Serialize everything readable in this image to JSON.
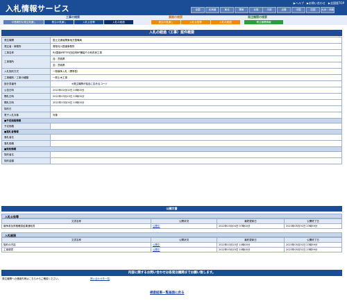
{
  "header": {
    "title": "入札情報サービス",
    "top_links": [
      "▶ヘルプ",
      "▶お問い合わせ",
      "▶全国版TOP"
    ],
    "regions_row1": [
      "全国",
      "北海道",
      "東北",
      "関東",
      "北陸",
      "中部",
      "近畿"
    ],
    "regions_row2": [
      "中国",
      "四国",
      "九州・沖縄"
    ]
  },
  "categories": {
    "koji_label": "工事の検索",
    "kikan_label": "業務の検索",
    "hatchu_label": "発注機関の検索",
    "tabs_koji": [
      "中長期的な発注見通し",
      "発注の見通し",
      "入札公告等",
      "入札の経過"
    ],
    "tabs_gyomu": [
      "発注の見通し",
      "入札公告等",
      "入札の経過"
    ],
    "tabs_hatchu": [
      "発注機関情報"
    ]
  },
  "main": {
    "title": "入札の経過（工事）案件概要",
    "rows": [
      {
        "label": "発注機関",
        "value": "国土交通省関東地方整備局"
      },
      {
        "label": "発注者・事務所",
        "value": "常陸河川国道事務所"
      },
      {
        "label": "工事名称",
        "value": "R4国道6号千代田石岡BP舗装その他改良工事"
      },
      {
        "label": "工事場所",
        "value": "自：茨城県",
        "value2": "至：茨城県"
      },
      {
        "label": "入札契約方式",
        "value": "一般競争入札（標準型）"
      },
      {
        "label": "工事種別／工事の種類",
        "value": "一般土木工事"
      },
      {
        "label": "設計書番号",
        "value": "※発注機関が独自に定めるコード"
      },
      {
        "label": "公告日時",
        "value": "2022年02月02日 10時00分"
      },
      {
        "label": "開札日時",
        "value": "2022年03月15日 10時00分"
      },
      {
        "label": "開札日時",
        "value": "2022年03月05日 10時00分"
      },
      {
        "label": "契約日",
        "value": ""
      },
      {
        "label": "電子入札対象",
        "value": "対象"
      }
    ],
    "yotei_section": "■予定価格情報",
    "yotei_rows": [
      {
        "label": "予定価格",
        "value": ""
      }
    ],
    "rakusatsu_section": "■落札者情報",
    "rakusatsu_rows": [
      {
        "label": "落札者名",
        "value": ""
      },
      {
        "label": "落札価格",
        "value": ""
      }
    ],
    "keiyaku_section": "■契約情報",
    "keiyaku_rows": [
      {
        "label": "契約者名",
        "value": ""
      },
      {
        "label": "契約金額",
        "value": ""
      }
    ]
  },
  "documents": {
    "title": "公開文書",
    "koukoku_title": "入札公告等",
    "headers": [
      "文書名称",
      "公開状況",
      "最終更新日",
      "公開終了日"
    ],
    "koukoku_rows": [
      {
        "name": "競争参加資格確認結果通知書",
        "status": "公開中",
        "updated": "2022年03月04日 07時00分",
        "end": "2023年05月31日 23時59分"
      }
    ],
    "keika_title": "入札経過",
    "keika_rows": [
      {
        "name": "契約の内容",
        "status": "公開中",
        "updated": "2022年03月15日 10時00分",
        "end": "2023年05月31日 23時59分"
      },
      {
        "name": "工事調書",
        "status": "公開中",
        "updated": "2022年03月15日 10時00分",
        "end": "2023年05月31日 23時59分"
      }
    ]
  },
  "contact": {
    "title": "内容に関するお問い合わせは各発注機関までお願い致します。",
    "text": "発注機関への連絡先等はこちらからご確認ください。",
    "link": "問い合わせ先一覧"
  },
  "back_link": "検索結果一覧画面に戻る",
  "colors": {
    "header_blue": "#1a4d96",
    "tab_blue": "#1a4d96",
    "tab_orange": "#f08c00",
    "tab_green": "#2f9c3c"
  }
}
